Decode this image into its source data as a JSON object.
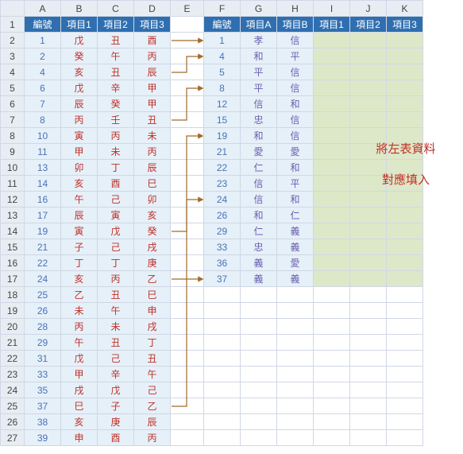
{
  "columns": [
    "A",
    "B",
    "C",
    "D",
    "E",
    "F",
    "G",
    "H",
    "I",
    "J",
    "K"
  ],
  "row_numbers": [
    1,
    2,
    3,
    4,
    5,
    6,
    7,
    8,
    9,
    10,
    11,
    12,
    13,
    14,
    15,
    16,
    17,
    18,
    19,
    20,
    21,
    22,
    23,
    24,
    25,
    26,
    27
  ],
  "left_headers": [
    "編號",
    "項目1",
    "項目2",
    "項目3"
  ],
  "right_headers": [
    "編號",
    "項目A",
    "項目B",
    "項目1",
    "項目2",
    "項目3"
  ],
  "left_rows": [
    {
      "n": "1",
      "a": "戊",
      "b": "丑",
      "c": "酉"
    },
    {
      "n": "2",
      "a": "癸",
      "b": "午",
      "c": "丙"
    },
    {
      "n": "4",
      "a": "亥",
      "b": "丑",
      "c": "辰"
    },
    {
      "n": "6",
      "a": "戊",
      "b": "辛",
      "c": "甲"
    },
    {
      "n": "7",
      "a": "辰",
      "b": "癸",
      "c": "甲"
    },
    {
      "n": "8",
      "a": "丙",
      "b": "壬",
      "c": "丑"
    },
    {
      "n": "10",
      "a": "寅",
      "b": "丙",
      "c": "未"
    },
    {
      "n": "11",
      "a": "甲",
      "b": "未",
      "c": "丙"
    },
    {
      "n": "13",
      "a": "卯",
      "b": "丁",
      "c": "辰"
    },
    {
      "n": "14",
      "a": "亥",
      "b": "酉",
      "c": "巳"
    },
    {
      "n": "16",
      "a": "午",
      "b": "己",
      "c": "卯"
    },
    {
      "n": "17",
      "a": "辰",
      "b": "寅",
      "c": "亥"
    },
    {
      "n": "19",
      "a": "寅",
      "b": "戊",
      "c": "癸"
    },
    {
      "n": "21",
      "a": "子",
      "b": "己",
      "c": "戌"
    },
    {
      "n": "22",
      "a": "丁",
      "b": "丁",
      "c": "庚"
    },
    {
      "n": "24",
      "a": "亥",
      "b": "丙",
      "c": "乙"
    },
    {
      "n": "25",
      "a": "乙",
      "b": "丑",
      "c": "巳"
    },
    {
      "n": "26",
      "a": "未",
      "b": "午",
      "c": "申"
    },
    {
      "n": "28",
      "a": "丙",
      "b": "未",
      "c": "戌"
    },
    {
      "n": "29",
      "a": "午",
      "b": "丑",
      "c": "丁"
    },
    {
      "n": "31",
      "a": "戊",
      "b": "己",
      "c": "丑"
    },
    {
      "n": "33",
      "a": "甲",
      "b": "辛",
      "c": "午"
    },
    {
      "n": "35",
      "a": "戌",
      "b": "戊",
      "c": "己"
    },
    {
      "n": "37",
      "a": "巳",
      "b": "子",
      "c": "乙"
    },
    {
      "n": "38",
      "a": "亥",
      "b": "庚",
      "c": "辰"
    },
    {
      "n": "39",
      "a": "申",
      "b": "酉",
      "c": "丙"
    }
  ],
  "right_rows": [
    {
      "n": "1",
      "a": "孝",
      "b": "信"
    },
    {
      "n": "4",
      "a": "和",
      "b": "平"
    },
    {
      "n": "5",
      "a": "平",
      "b": "信"
    },
    {
      "n": "8",
      "a": "平",
      "b": "信"
    },
    {
      "n": "12",
      "a": "信",
      "b": "和"
    },
    {
      "n": "15",
      "a": "忠",
      "b": "信"
    },
    {
      "n": "19",
      "a": "和",
      "b": "信"
    },
    {
      "n": "21",
      "a": "愛",
      "b": "愛"
    },
    {
      "n": "22",
      "a": "仁",
      "b": "和"
    },
    {
      "n": "23",
      "a": "信",
      "b": "平"
    },
    {
      "n": "24",
      "a": "信",
      "b": "和"
    },
    {
      "n": "26",
      "a": "和",
      "b": "仁"
    },
    {
      "n": "29",
      "a": "仁",
      "b": "義"
    },
    {
      "n": "33",
      "a": "忠",
      "b": "義"
    },
    {
      "n": "36",
      "a": "義",
      "b": "愛"
    },
    {
      "n": "37",
      "a": "義",
      "b": "義"
    }
  ],
  "annotation": {
    "line1": "將左表資料",
    "line2": "對應填入"
  },
  "arrows_color": "#a06a2a",
  "chart_data": {
    "type": "table",
    "description": "Two Excel tables. Left table (columns A-D) has 編號 + 項目1..3. Right table (F-K) has 編號 + 項目A/B and blank 項目1..3 to be filled from left where 編號 matches. Arrows connect matching 編號 rows.",
    "left_table_columns": [
      "編號",
      "項目1",
      "項目2",
      "項目3"
    ],
    "right_table_columns": [
      "編號",
      "項目A",
      "項目B",
      "項目1",
      "項目2",
      "項目3"
    ],
    "mappings": [
      {
        "from_left_row": 2,
        "to_right_row": 2,
        "id": "1"
      },
      {
        "from_left_row": 4,
        "to_right_row": 3,
        "id": "4"
      },
      {
        "from_left_row": 7,
        "to_right_row": 5,
        "id": "8"
      },
      {
        "from_left_row": 14,
        "to_right_row": 8,
        "id": "19"
      },
      {
        "from_left_row": 17,
        "to_right_row": 12,
        "id": "24"
      },
      {
        "from_left_row": 25,
        "to_right_row": 17,
        "id": "37"
      }
    ]
  }
}
